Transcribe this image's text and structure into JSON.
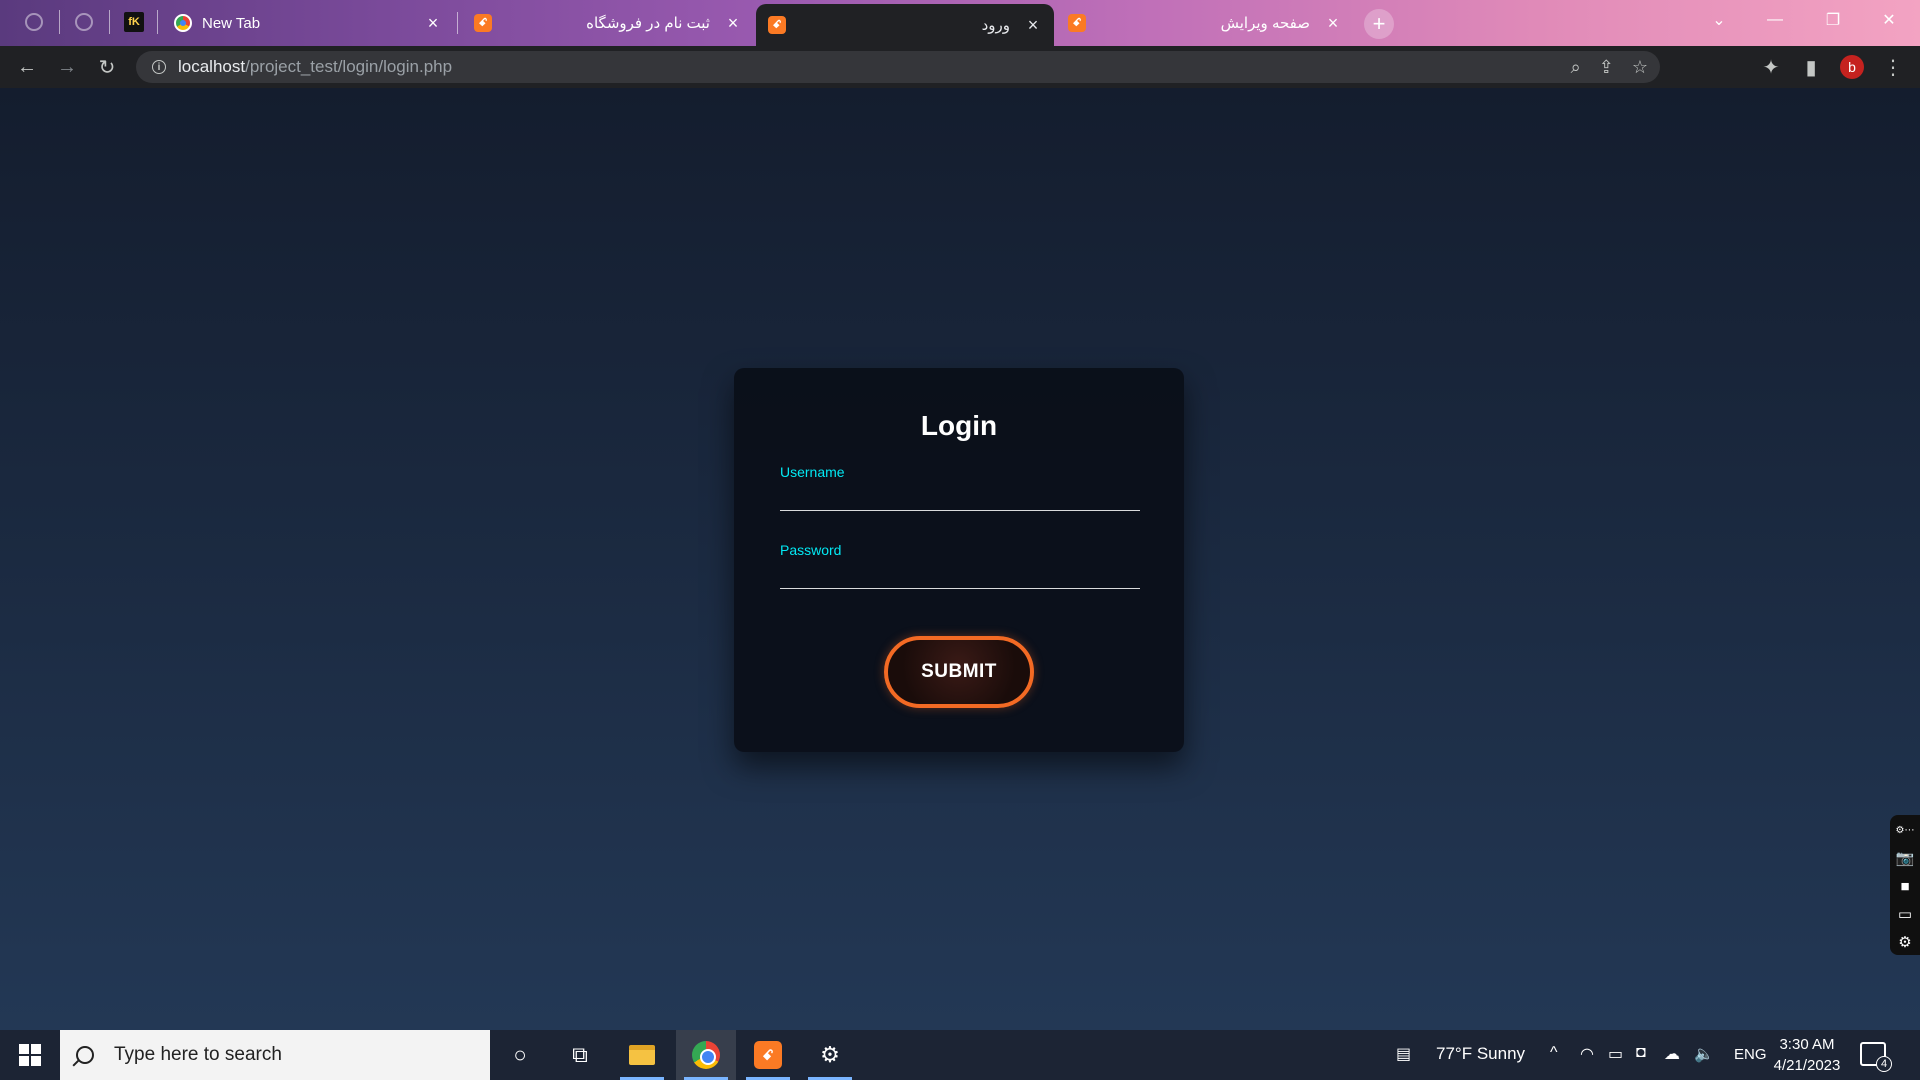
{
  "browser": {
    "tabs": [
      {
        "title": "New Tab",
        "icon": "chrome-icon"
      },
      {
        "title": "ثبت نام در فروشگاه",
        "icon": "xampp-icon"
      },
      {
        "title": "ورود",
        "icon": "xampp-icon",
        "active": true
      },
      {
        "title": "صفحه ویرایش",
        "icon": "xampp-icon"
      }
    ],
    "pinned_favicon_fk": "fK",
    "url_host": "localhost",
    "url_path": "/project_test/login/login.php",
    "profile_initial": "b"
  },
  "login": {
    "title": "Login",
    "username_label": "Username",
    "password_label": "Password",
    "submit_label": "SUBMIT",
    "accent_color": "#03e9f4",
    "button_border_color": "#f36a24"
  },
  "taskbar": {
    "search_placeholder": "Type here to search",
    "weather": "77°F  Sunny",
    "language": "ENG",
    "time": "3:30 AM",
    "date": "4/21/2023",
    "notification_count": "4"
  }
}
